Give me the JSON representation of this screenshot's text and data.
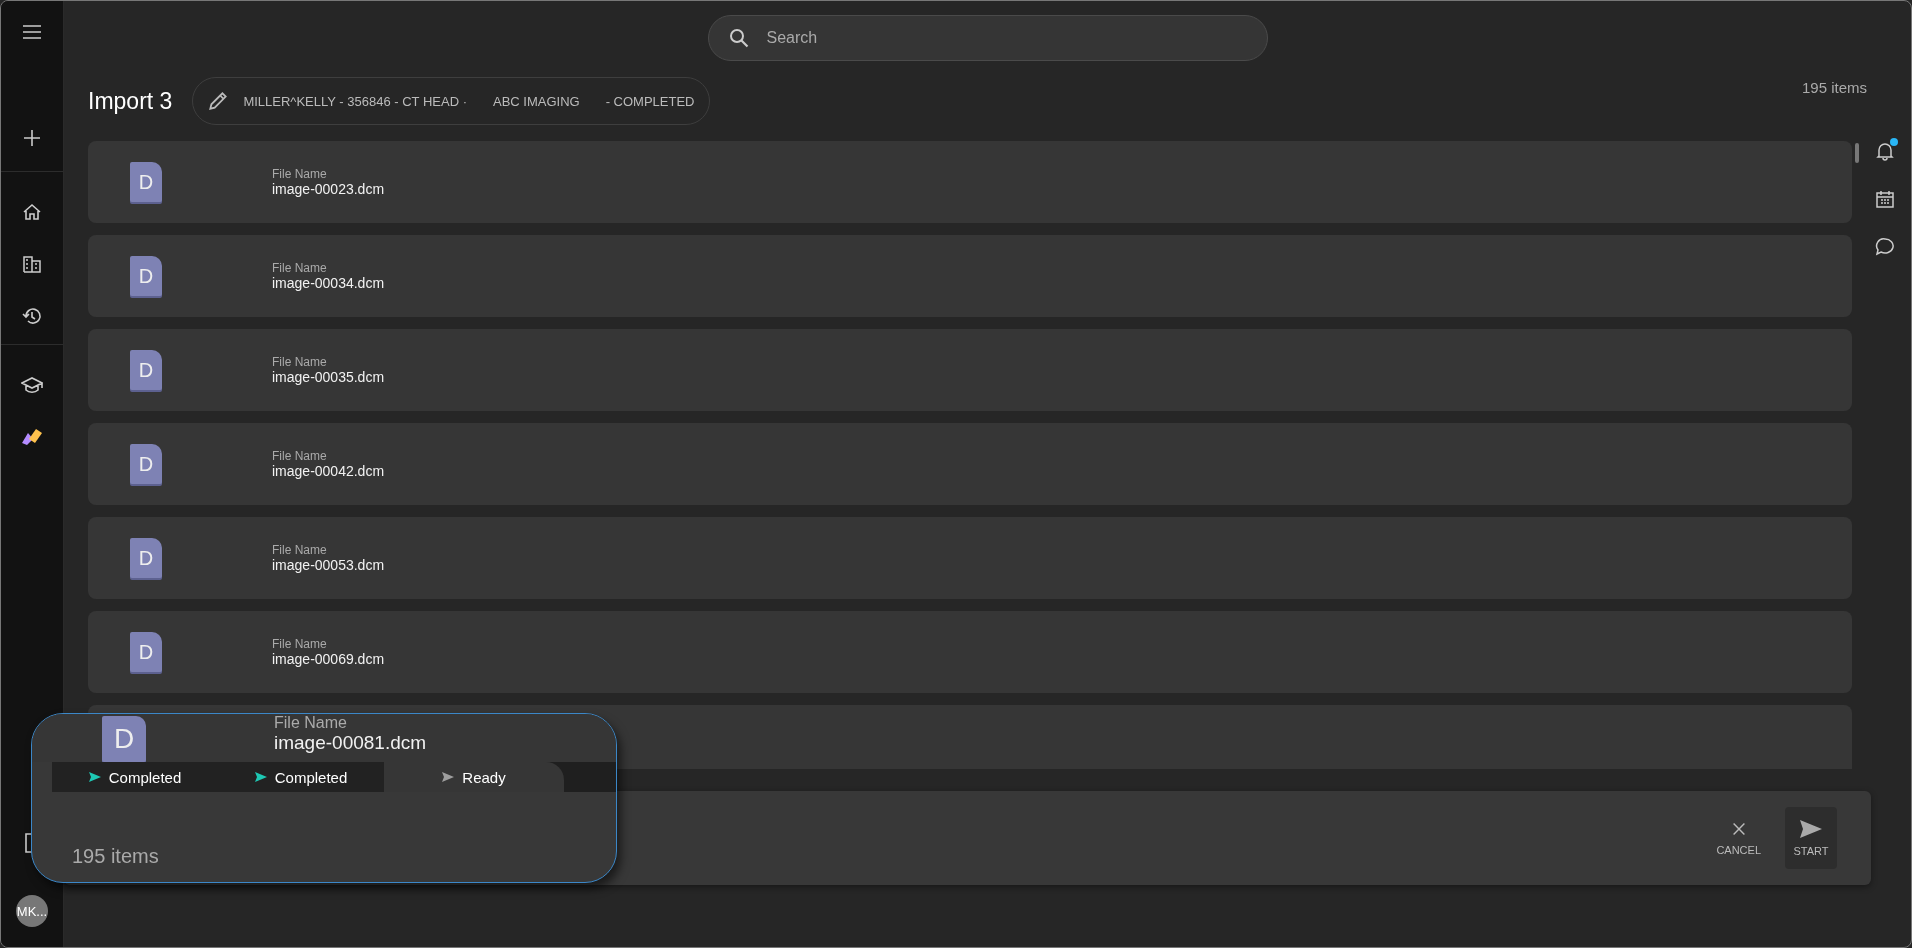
{
  "sidebar": {
    "avatar": "MK..."
  },
  "search": {
    "placeholder": "Search"
  },
  "header": {
    "title": "Import 3",
    "chip": [
      "MILLER^KELLY - 356846 - CT HEAD ·",
      "ABC IMAGING",
      "- COMPLETED"
    ],
    "count": "195 items"
  },
  "rows": [
    {
      "icon_text": "D",
      "label": "File Name",
      "name": "image-00023.dcm"
    },
    {
      "icon_text": "D",
      "label": "File Name",
      "name": "image-00034.dcm"
    },
    {
      "icon_text": "D",
      "label": "File Name",
      "name": "image-00035.dcm"
    },
    {
      "icon_text": "D",
      "label": "File Name",
      "name": "image-00042.dcm"
    },
    {
      "icon_text": "D",
      "label": "File Name",
      "name": "image-00053.dcm"
    },
    {
      "icon_text": "D",
      "label": "File Name",
      "name": "image-00069.dcm"
    }
  ],
  "rail": {
    "notification": true
  },
  "footer": {
    "buttons": [
      {
        "label": "CANCEL",
        "kind": "cancel"
      },
      {
        "label": "START",
        "kind": "start"
      }
    ]
  },
  "drag_preview": {
    "icon_text": "D",
    "label": "File Name",
    "name": "image-00081.dcm",
    "tabs": [
      {
        "label": "Completed",
        "selected": false,
        "color": "#1ec8b4"
      },
      {
        "label": "Completed",
        "selected": false,
        "color": "#1ec8b4"
      },
      {
        "label": "Ready",
        "selected": true,
        "color": "#9e9e9e"
      }
    ],
    "count": "195 items"
  }
}
